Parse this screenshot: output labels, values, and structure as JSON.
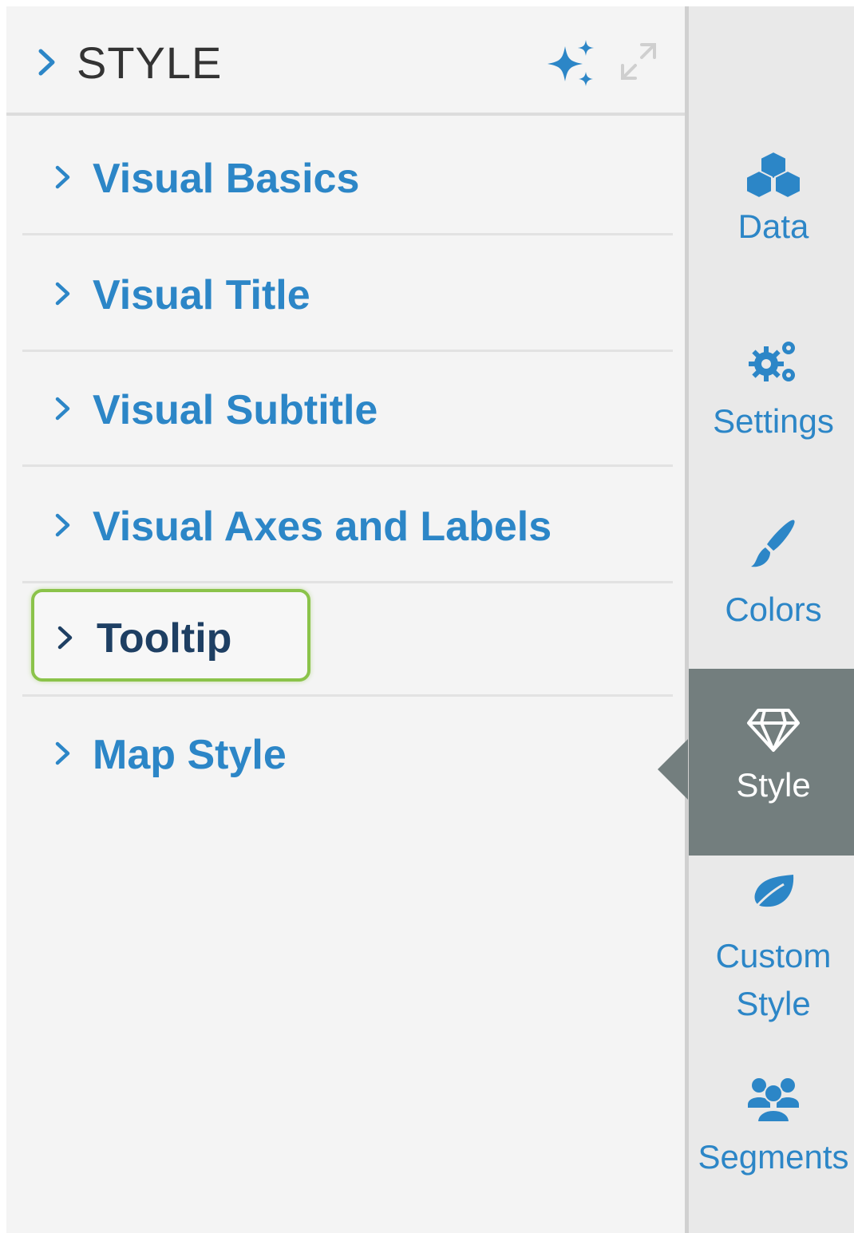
{
  "header": {
    "title": "STYLE",
    "icons": [
      "chevron-right-icon",
      "sparkle-icon",
      "expand-icon"
    ]
  },
  "sections": [
    {
      "label": "Visual Basics"
    },
    {
      "label": "Visual Title"
    },
    {
      "label": "Visual Subtitle"
    },
    {
      "label": "Visual Axes and Labels"
    },
    {
      "label": "Tooltip",
      "highlighted": true
    },
    {
      "label": "Map Style"
    }
  ],
  "rail": {
    "items": [
      {
        "label": "Data",
        "icon": "cubes-icon"
      },
      {
        "label": "Settings",
        "icon": "gears-icon"
      },
      {
        "label": "Colors",
        "icon": "paintbrush-icon"
      },
      {
        "label": "Style",
        "icon": "diamond-icon",
        "active": true
      },
      {
        "label_line1": "Custom",
        "label_line2": "Style",
        "icon": "leaf-icon"
      },
      {
        "label": "Segments",
        "icon": "users-icon"
      }
    ]
  },
  "colors": {
    "accent": "#2c86c7",
    "highlight_border": "#8bc34a",
    "active_tab": "#737e7e",
    "tooltip_label": "#1e3f63"
  }
}
